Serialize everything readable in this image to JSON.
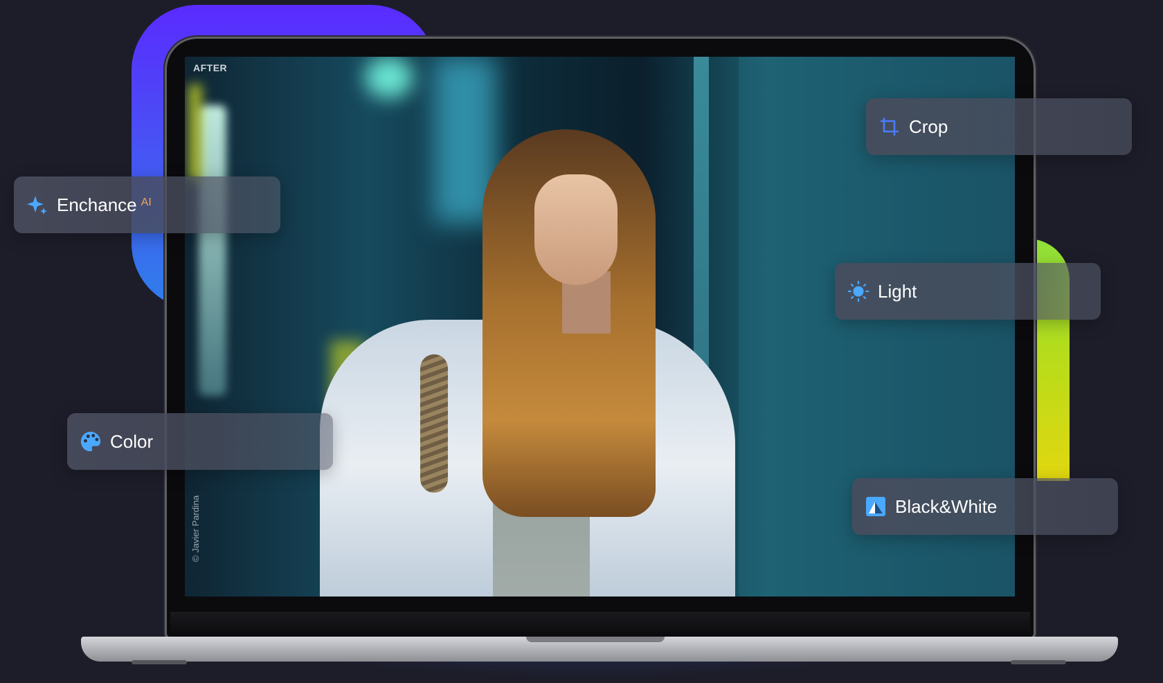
{
  "screen": {
    "badge": "AFTER",
    "photo_credit": "© Javier Pardina"
  },
  "tools": {
    "enhance": {
      "label": "Enchance",
      "tag": "AI",
      "icon": "sparkle-icon"
    },
    "crop": {
      "label": "Crop",
      "icon": "crop-icon"
    },
    "light": {
      "label": "Light",
      "icon": "sun-icon"
    },
    "color": {
      "label": "Color",
      "icon": "palette-icon"
    },
    "bw": {
      "label": "Black&White",
      "icon": "black-white-icon"
    }
  },
  "colors": {
    "accent_purple": "#5a2bff",
    "accent_green": "#b8dc1a",
    "icon_blue": "#4aa8ff",
    "ai_tag": "#f3a35a",
    "background": "#1c1d29"
  }
}
